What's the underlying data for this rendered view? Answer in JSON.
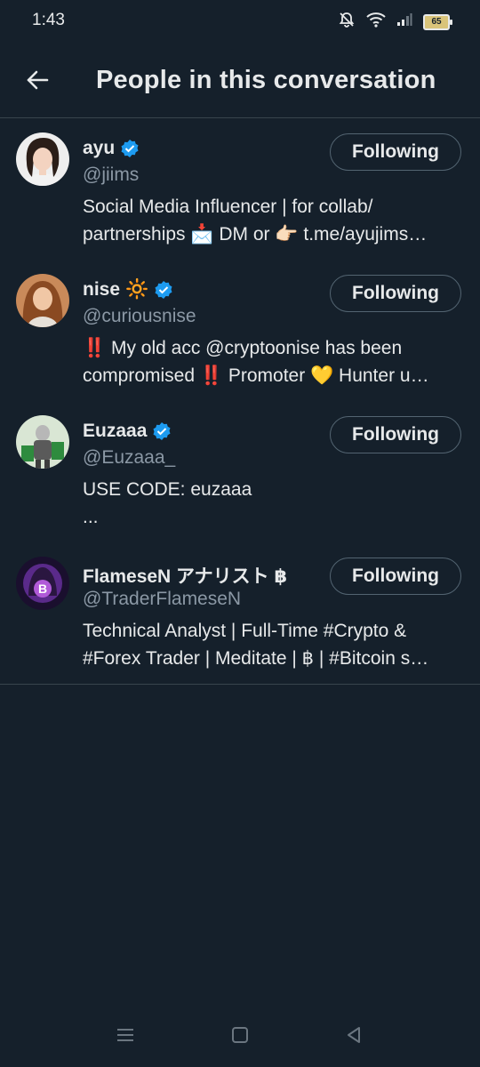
{
  "status_bar": {
    "time": "1:43",
    "battery": "65",
    "icons": [
      "mute-icon",
      "wifi-icon",
      "signal-icon",
      "battery-icon"
    ]
  },
  "header": {
    "title": "People in this conversation",
    "back_icon": "arrow-left-icon"
  },
  "users": [
    {
      "name": "ayu",
      "name_suffix": "",
      "handle": "@jiims",
      "verified": true,
      "button": "Following",
      "bio": [
        "Social Media Influencer | for collab/",
        "partnerships 📩 DM or 👉🏻 t.me/ayujims…"
      ]
    },
    {
      "name": "nise",
      "name_suffix": "🔆",
      "handle": "@curiousnise",
      "verified": true,
      "button": "Following",
      "bio": [
        "‼️ My old acc @cryptoonise has been",
        "compromised ‼️ Promoter 💛 Hunter u…"
      ]
    },
    {
      "name": "Euzaaa",
      "name_suffix": "",
      "handle": "@Euzaaa_",
      "verified": true,
      "button": "Following",
      "bio": [
        "USE CODE: euzaaa",
        "..."
      ]
    },
    {
      "name": "FlameseN アナリスト ฿",
      "name_suffix": "",
      "handle": "@TraderFlameseN",
      "verified": false,
      "button": "Following",
      "bio": [
        "Technical Analyst | Full-Time #Crypto &",
        "#Forex Trader | Meditate | ฿ | #Bitcoin s…"
      ]
    }
  ],
  "colors": {
    "background": "#15202b",
    "divider": "#38444d",
    "text_secondary": "#8b98a5",
    "verified_blue": "#1d9bf0",
    "button_border": "#536471"
  },
  "nav_bar": {
    "icons": [
      "recent-apps-icon",
      "home-icon",
      "back-icon"
    ]
  }
}
